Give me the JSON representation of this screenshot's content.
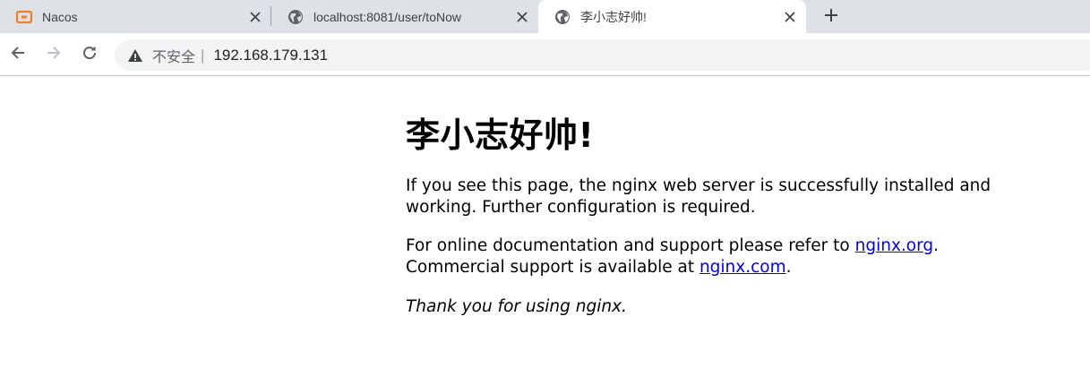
{
  "browser": {
    "tabs": [
      {
        "title": "Nacos",
        "favicon": "nacos-logo-icon",
        "active": false
      },
      {
        "title": "localhost:8081/user/toNow",
        "favicon": "globe-icon",
        "active": false
      },
      {
        "title": "李小志好帅!",
        "favicon": "globe-icon",
        "active": true
      }
    ],
    "omnibox": {
      "security_label": "不安全",
      "separator": "|",
      "url": "192.168.179.131"
    }
  },
  "page": {
    "heading": "李小志好帅!",
    "para1_line1": "If you see this page, the nginx web server is successfully installed and",
    "para1_line2": "working. Further configuration is required.",
    "para2_prefix": "For online documentation and support please refer to ",
    "link_org": "nginx.org",
    "para2_suffix": ".",
    "para2_line2_prefix": "Commercial support is available at ",
    "link_com": "nginx.com",
    "para2_line2_suffix": ".",
    "thanks": "Thank you for using nginx."
  },
  "colors": {
    "tabstrip": "#dee1e6",
    "active_tab": "#ffffff",
    "link": "#0000ee",
    "nacos_orange": "#f57c26"
  }
}
